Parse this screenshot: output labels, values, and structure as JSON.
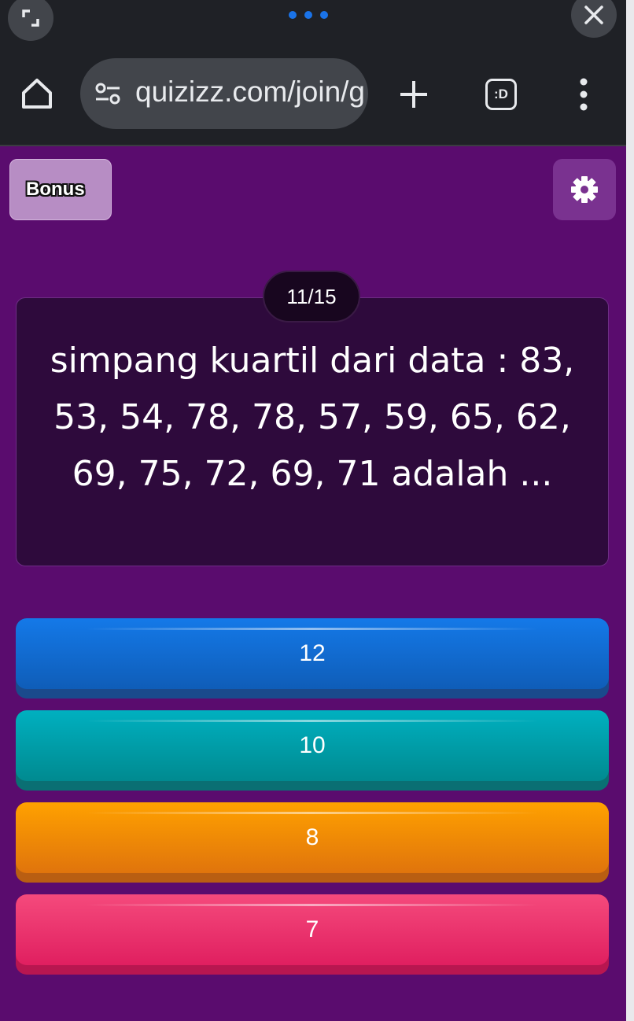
{
  "browser": {
    "url": "quizizz.com/join/g",
    "tab_count_label": ":D"
  },
  "quiz": {
    "bonus_label": "Bonus",
    "counter": "11/15",
    "question": "simpang kuartil dari data : 83, 53, 54, 78, 78, 57, 59, 65, 62, 69, 75, 72, 69, 71 adalah ...",
    "answers": [
      {
        "label": "12",
        "color": "#1479e8"
      },
      {
        "label": "10",
        "color": "#00b0c0"
      },
      {
        "label": "8",
        "color": "#ffa100"
      },
      {
        "label": "7",
        "color": "#f54a7c"
      }
    ]
  },
  "icons": {
    "expand": "expand-window-icon",
    "close": "close-icon",
    "home": "home-icon",
    "site_info": "tune-icon",
    "new_tab": "plus-icon",
    "menu": "more-vert-icon",
    "settings": "gear-icon"
  },
  "colors": {
    "background": "#5a0c6e",
    "card": "#2e0a3c",
    "accent_dots": "#1a73e8"
  }
}
